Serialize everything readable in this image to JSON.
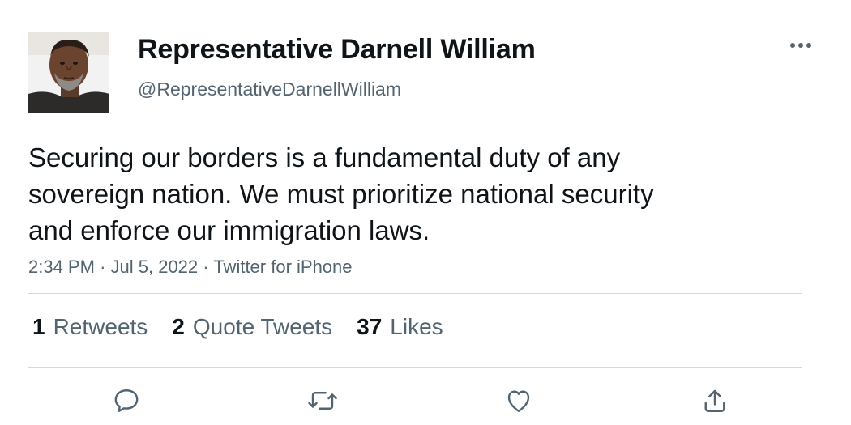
{
  "author": {
    "display_name": "Representative Darnell William",
    "handle": "@RepresentativeDarnellWilliam",
    "avatar_icon": "profile-photo"
  },
  "tweet": {
    "lines": [
      "Securing our borders is a fundamental duty of any",
      "sovereign nation. We must prioritize national security",
      "and enforce our immigration laws."
    ]
  },
  "meta": {
    "time": "2:34 PM",
    "separator": "·",
    "date": "Jul 5, 2022",
    "source": "Twitter for iPhone"
  },
  "stats": {
    "retweets_count": "1",
    "retweets_label": "Retweets",
    "quotes_count": "2",
    "quotes_label": "Quote Tweets",
    "likes_count": "37",
    "likes_label": "Likes"
  },
  "actions": [
    "reply-icon",
    "retweet-icon",
    "like-icon",
    "share-icon"
  ],
  "colors": {
    "text_primary": "#0f1419",
    "text_secondary": "#536471",
    "divider": "#cfd9de"
  }
}
